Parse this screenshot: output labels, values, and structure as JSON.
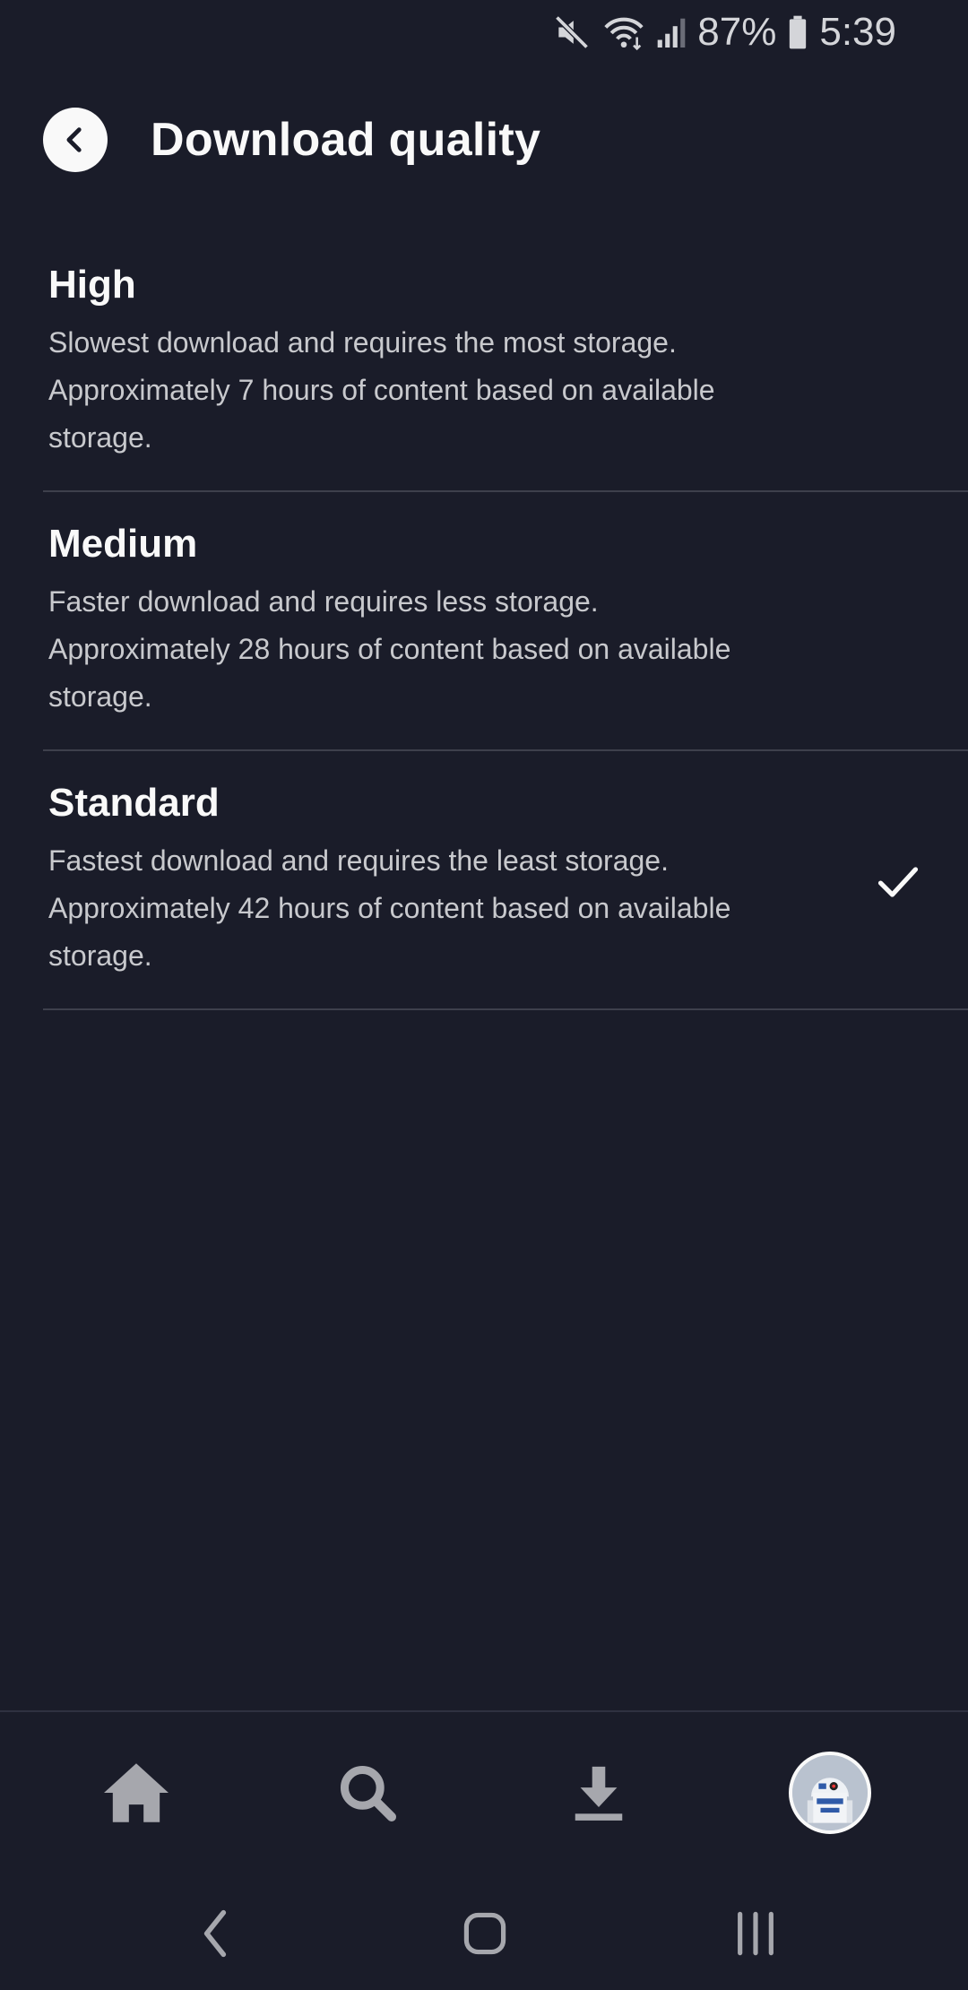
{
  "status_bar": {
    "battery": "87%",
    "time": "5:39",
    "icons": [
      "mute-icon",
      "wifi-icon",
      "signal-icon",
      "battery-icon"
    ]
  },
  "header": {
    "title": "Download quality",
    "back_icon": "back-arrow-icon"
  },
  "options": [
    {
      "title": "High",
      "desc_lines": [
        "Slowest download and requires the most storage.",
        "Approximately 7 hours of content based on available",
        "storage."
      ],
      "selected": false
    },
    {
      "title": "Medium",
      "desc_lines": [
        "Faster download and requires less storage.",
        "Approximately 28 hours of content based on available",
        "storage."
      ],
      "selected": false
    },
    {
      "title": "Standard",
      "desc_lines": [
        "Fastest download and requires the least storage.",
        "Approximately 42 hours of content based on available",
        "storage."
      ],
      "selected": true
    }
  ],
  "bottom_nav": {
    "items": [
      "home-icon",
      "search-icon",
      "download-icon",
      "profile-avatar"
    ]
  },
  "system_nav": {
    "items": [
      "back-icon",
      "home-icon",
      "recents-icon"
    ]
  },
  "colors": {
    "background": "#1a1c29",
    "text_primary": "#f9f9f9",
    "text_secondary": "#c8c9cd",
    "divider": "#3e404c",
    "icon_gray": "#a6a7ad"
  }
}
